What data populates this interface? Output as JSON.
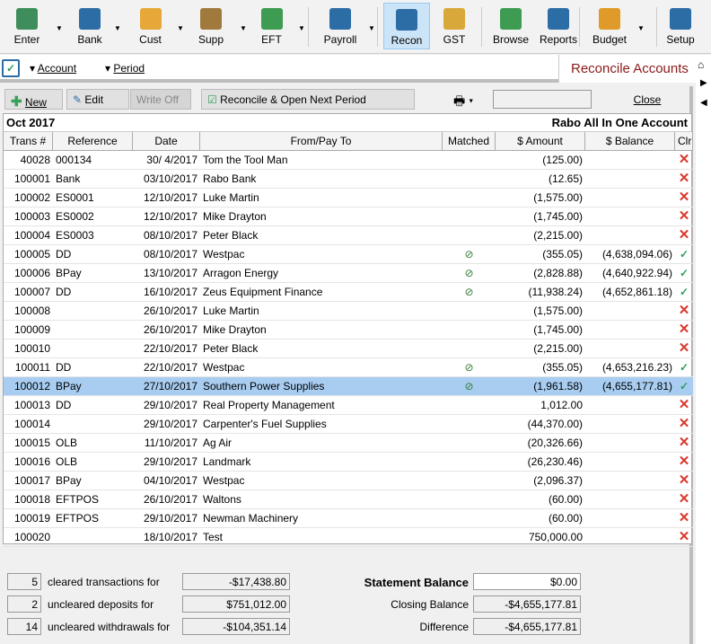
{
  "toolbar": {
    "items": [
      {
        "label": "Enter",
        "icon": "enter-icon",
        "color": "#3d8e5a",
        "dd": true
      },
      {
        "label": "Bank",
        "icon": "bank-icon",
        "color": "#2d6da6",
        "dd": true
      },
      {
        "label": "Cust",
        "icon": "customers-icon",
        "color": "#e6a838",
        "dd": true
      },
      {
        "label": "Supp",
        "icon": "suppliers-icon",
        "color": "#a07a3c",
        "dd": true
      },
      {
        "label": "EFT",
        "icon": "eft-icon",
        "color": "#3e9b52",
        "dd": true
      },
      {
        "label": "Payroll",
        "icon": "payroll-icon",
        "color": "#2d6da6",
        "dd": true
      },
      {
        "label": "Recon",
        "icon": "reconcile-icon",
        "color": "#2d6da6",
        "dd": false,
        "active": true
      },
      {
        "label": "GST",
        "icon": "gst-icon",
        "color": "#d9a83a",
        "dd": false
      },
      {
        "label": "Browse",
        "icon": "browse-icon",
        "color": "#3e9b52",
        "dd": false
      },
      {
        "label": "Reports",
        "icon": "reports-icon",
        "color": "#2d6da6",
        "dd": false
      },
      {
        "label": "Budget",
        "icon": "budget-icon",
        "color": "#e09a2a",
        "dd": true
      },
      {
        "label": "Setup",
        "icon": "setup-icon",
        "color": "#2d6da6",
        "dd": false
      }
    ]
  },
  "subbar": {
    "account": "Account",
    "period": "Period",
    "title": "Reconcile Accounts"
  },
  "buttons": {
    "new": "New",
    "edit": "Edit",
    "write_off": "Write Off",
    "reconcile": "Reconcile & Open Next Period",
    "close": "Close"
  },
  "grid": {
    "period": "Oct 2017",
    "account": "Rabo All In One Account",
    "columns": [
      "Trans #",
      "Reference",
      "Date",
      "From/Pay To",
      "Matched",
      "$ Amount",
      "$ Balance",
      "Clr"
    ],
    "rows": [
      [
        "40028",
        "000134",
        "30/ 4/2017",
        "Tom the Tool Man",
        false,
        "(125.00)",
        "",
        false
      ],
      [
        "100001",
        "Bank",
        "03/10/2017",
        "Rabo Bank",
        false,
        "(12.65)",
        "",
        false
      ],
      [
        "100002",
        "ES0001",
        "12/10/2017",
        "Luke Martin",
        false,
        "(1,575.00)",
        "",
        false
      ],
      [
        "100003",
        "ES0002",
        "12/10/2017",
        "Mike Drayton",
        false,
        "(1,745.00)",
        "",
        false
      ],
      [
        "100004",
        "ES0003",
        "08/10/2017",
        "Peter Black",
        false,
        "(2,215.00)",
        "",
        false
      ],
      [
        "100005",
        "DD",
        "08/10/2017",
        "Westpac",
        true,
        "(355.05)",
        "(4,638,094.06)",
        true
      ],
      [
        "100006",
        "BPay",
        "13/10/2017",
        "Arragon Energy",
        true,
        "(2,828.88)",
        "(4,640,922.94)",
        true
      ],
      [
        "100007",
        "DD",
        "16/10/2017",
        "Zeus Equipment Finance",
        true,
        "(11,938.24)",
        "(4,652,861.18)",
        true
      ],
      [
        "100008",
        "",
        "26/10/2017",
        "Luke Martin",
        false,
        "(1,575.00)",
        "",
        false
      ],
      [
        "100009",
        "",
        "26/10/2017",
        "Mike Drayton",
        false,
        "(1,745.00)",
        "",
        false
      ],
      [
        "100010",
        "",
        "22/10/2017",
        "Peter Black",
        false,
        "(2,215.00)",
        "",
        false
      ],
      [
        "100011",
        "DD",
        "22/10/2017",
        "Westpac",
        true,
        "(355.05)",
        "(4,653,216.23)",
        true
      ],
      [
        "100012",
        "BPay",
        "27/10/2017",
        "Southern Power Supplies",
        true,
        "(1,961.58)",
        "(4,655,177.81)",
        true
      ],
      [
        "100013",
        "DD",
        "29/10/2017",
        "Real Property Management",
        false,
        "1,012.00",
        "",
        false
      ],
      [
        "100014",
        "",
        "29/10/2017",
        "Carpenter's Fuel Supplies",
        false,
        "(44,370.00)",
        "",
        false
      ],
      [
        "100015",
        "OLB",
        "11/10/2017",
        "Ag Air",
        false,
        "(20,326.66)",
        "",
        false
      ],
      [
        "100016",
        "OLB",
        "29/10/2017",
        "Landmark",
        false,
        "(26,230.46)",
        "",
        false
      ],
      [
        "100017",
        "BPay",
        "04/10/2017",
        "Westpac",
        false,
        "(2,096.37)",
        "",
        false
      ],
      [
        "100018",
        "EFTPOS",
        "26/10/2017",
        "Waltons",
        false,
        "(60.00)",
        "",
        false
      ],
      [
        "100019",
        "EFTPOS",
        "29/10/2017",
        "Newman Machinery",
        false,
        "(60.00)",
        "",
        false
      ],
      [
        "100020",
        "",
        "18/10/2017",
        "Test",
        false,
        "750,000.00",
        "",
        false
      ]
    ],
    "selected_row": 12
  },
  "summary": {
    "cleared_count": "5",
    "cleared_label": "cleared transactions for",
    "cleared_amount": "-$17,438.80",
    "deposits_count": "2",
    "deposits_label": "uncleared deposits for",
    "deposits_amount": "$751,012.00",
    "withdrawals_count": "14",
    "withdrawals_label": "uncleared withdrawals for",
    "withdrawals_amount": "-$104,351.14",
    "statement_label": "Statement Balance",
    "statement_value": "$0.00",
    "closing_label": "Closing Balance",
    "closing_value": "-$4,655,177.81",
    "difference_label": "Difference",
    "difference_value": "-$4,655,177.81"
  }
}
